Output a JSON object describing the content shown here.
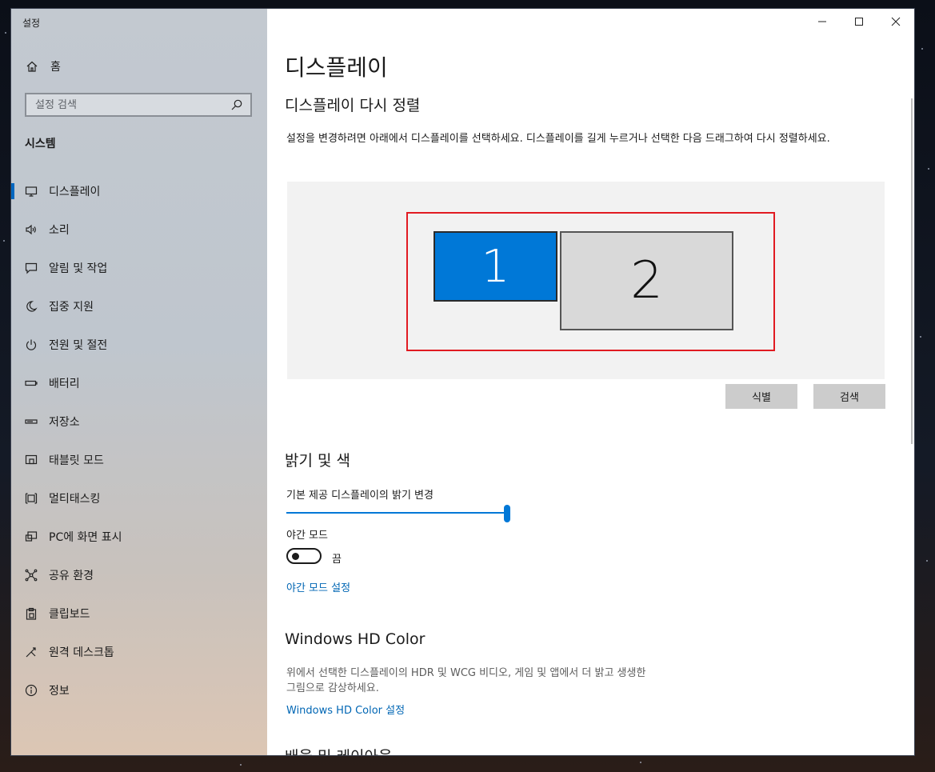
{
  "window": {
    "title": "설정"
  },
  "sidebar": {
    "home_label": "홈",
    "search_placeholder": "설정 검색",
    "section_title": "시스템",
    "items": [
      {
        "label": "디스플레이",
        "icon": "monitor-icon",
        "active": true
      },
      {
        "label": "소리",
        "icon": "speaker-icon"
      },
      {
        "label": "알림 및 작업",
        "icon": "notification-icon"
      },
      {
        "label": "집중 지원",
        "icon": "moon-icon"
      },
      {
        "label": "전원 및 절전",
        "icon": "power-icon"
      },
      {
        "label": "배터리",
        "icon": "battery-icon"
      },
      {
        "label": "저장소",
        "icon": "storage-icon"
      },
      {
        "label": "태블릿 모드",
        "icon": "tablet-icon"
      },
      {
        "label": "멀티태스킹",
        "icon": "multitasking-icon"
      },
      {
        "label": "PC에 화면 표시",
        "icon": "project-icon"
      },
      {
        "label": "공유 환경",
        "icon": "share-icon"
      },
      {
        "label": "클립보드",
        "icon": "clipboard-icon"
      },
      {
        "label": "원격 데스크톱",
        "icon": "remote-desktop-icon"
      },
      {
        "label": "정보",
        "icon": "info-icon"
      }
    ]
  },
  "main": {
    "title": "디스플레이",
    "rearrange_heading": "디스플레이 다시 정렬",
    "rearrange_desc": "설정을 변경하려면 아래에서 디스플레이를 선택하세요. 디스플레이를 길게 누르거나 선택한 다음 드래그하여 다시 정렬하세요.",
    "monitors": [
      "1",
      "2"
    ],
    "identify_label": "식별",
    "detect_label": "검색",
    "brightness_heading": "밝기 및 색",
    "brightness_label": "기본 제공 디스플레이의 밝기 변경",
    "brightness_value": 1.0,
    "night_light_label": "야간 모드",
    "night_light_state": "끔",
    "night_light_link": "야간 모드 설정",
    "hdr_heading": "Windows HD Color",
    "hdr_desc": "위에서 선택한 디스플레이의 HDR 및 WCG 비디오, 게임 및 앱에서 더 밝고 생생한 그림으로 감상하세요.",
    "hdr_link": "Windows HD Color 설정",
    "next_heading": "배율 및 레이아웃"
  },
  "colors": {
    "accent": "#0078d7",
    "highlight_border": "#e11b22"
  }
}
